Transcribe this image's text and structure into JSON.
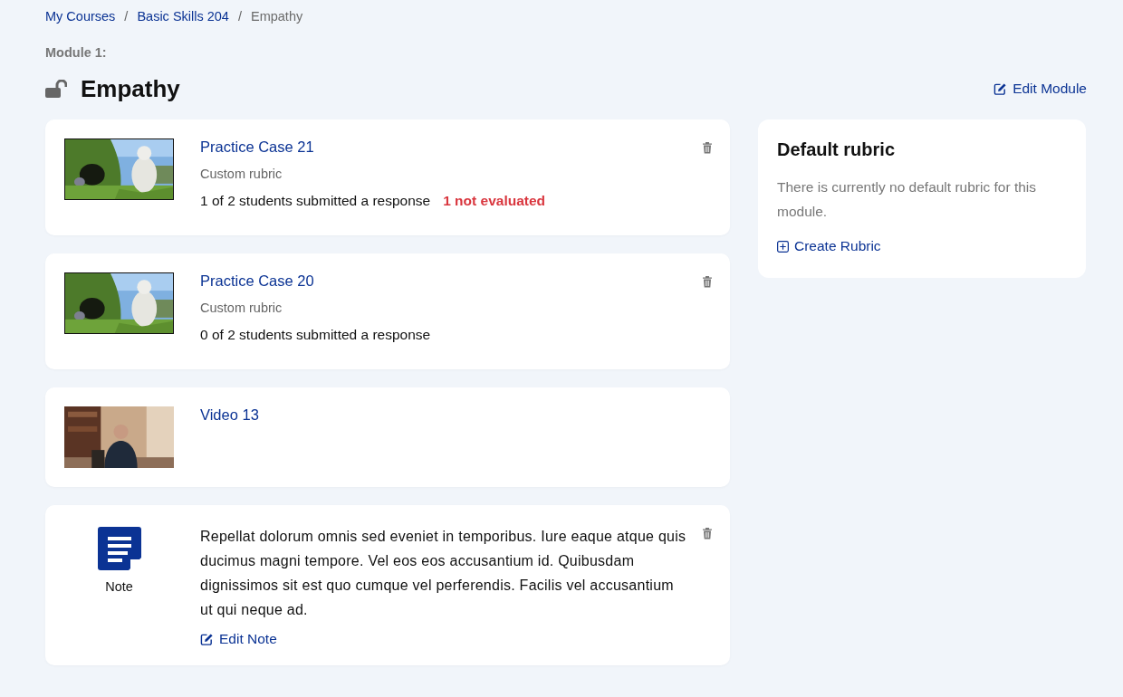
{
  "breadcrumbs": [
    {
      "kind": "link",
      "label": "My Courses"
    },
    {
      "kind": "separator",
      "label": "/"
    },
    {
      "kind": "link",
      "label": "Basic Skills 204"
    },
    {
      "kind": "separator",
      "label": "/"
    },
    {
      "kind": "current",
      "label": "Empathy"
    }
  ],
  "module": {
    "label": "Module 1:",
    "title": "Empathy",
    "locked": false,
    "edit_link": "Edit Module"
  },
  "items": [
    {
      "kind": "case",
      "title": "Practice Case 21",
      "rubric": "Custom rubric",
      "status": "1 of 2 students submitted a response",
      "alert": "1 not evaluated",
      "deletable": true
    },
    {
      "kind": "case",
      "title": "Practice Case 20",
      "rubric": "Custom rubric",
      "status": "0 of 2 students submitted a response",
      "deletable": true
    },
    {
      "kind": "video",
      "title": "Video 13",
      "deletable": false
    },
    {
      "kind": "note",
      "label": "Note",
      "text": "Repellat dolorum omnis sed eveniet in temporibus. Iure eaque atque quis ducimus magni tempore. Vel eos eos accusantium id. Quibusdam dignissimos sit est quo cumque vel perferendis. Facilis vel accusantium ut qui neque ad.",
      "edit_link": "Edit Note",
      "deletable": true
    }
  ],
  "rubric_panel": {
    "title": "Default rubric",
    "text": "There is currently no default rubric for this module.",
    "create_link": "Create Rubric"
  }
}
